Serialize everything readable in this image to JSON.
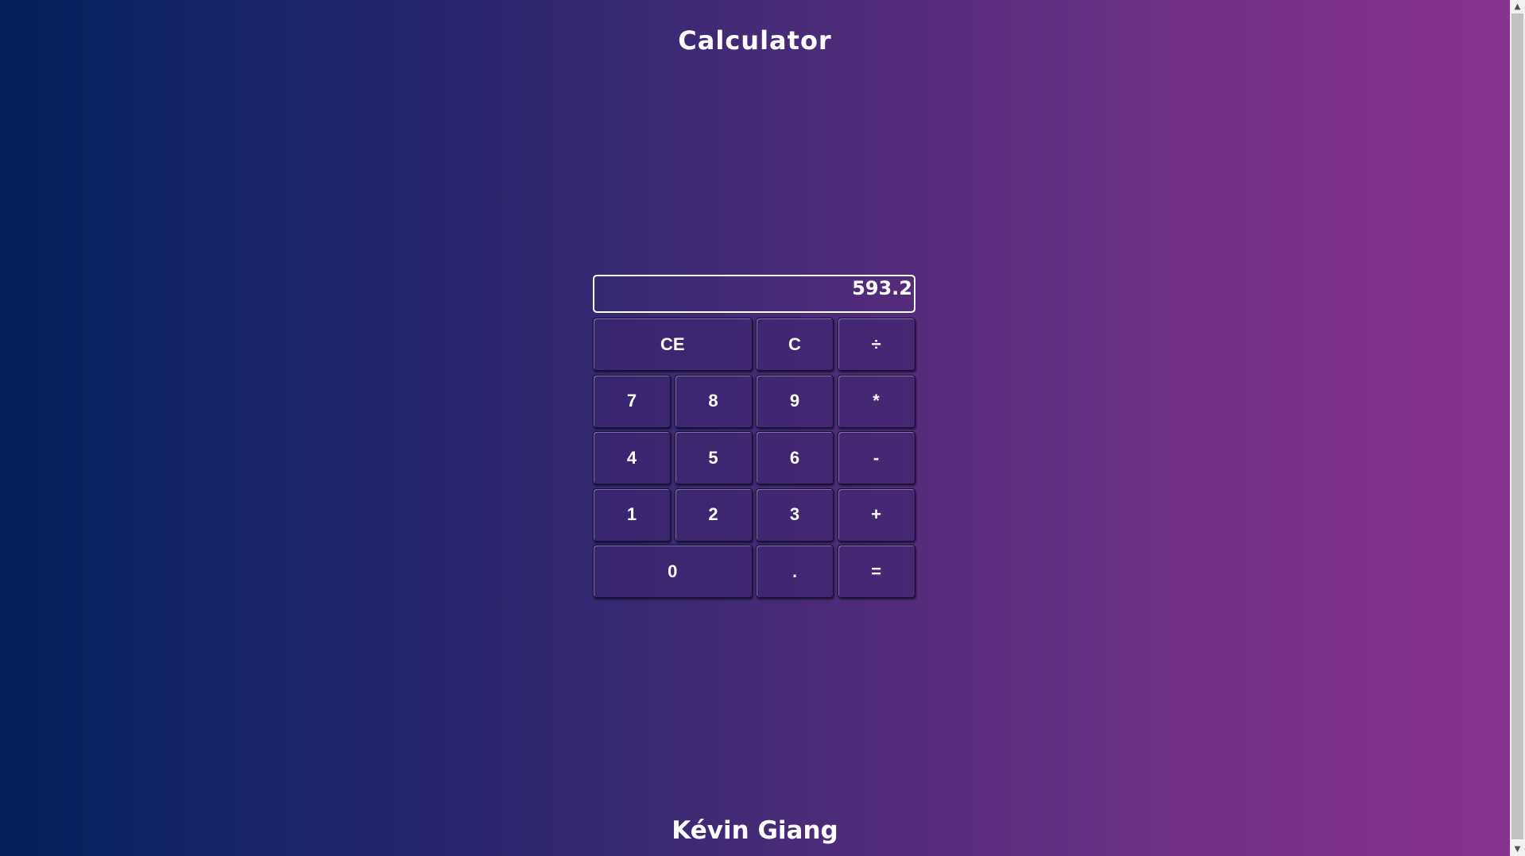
{
  "app": {
    "title": "Calculator",
    "footer": "Kévin Giang"
  },
  "display": {
    "value": "593.2"
  },
  "keys": {
    "ce": "CE",
    "c": "C",
    "divide": "÷",
    "seven": "7",
    "eight": "8",
    "nine": "9",
    "multiply": "*",
    "four": "4",
    "five": "5",
    "six": "6",
    "minus": "-",
    "one": "1",
    "two": "2",
    "three": "3",
    "plus": "+",
    "zero": "0",
    "dot": ".",
    "equals": "="
  },
  "scrollbar": {
    "up_icon": "▲",
    "down_icon": "▼"
  },
  "colors": {
    "gradient_start": "#03205c",
    "gradient_end": "#88328f",
    "text": "#ffffff"
  }
}
